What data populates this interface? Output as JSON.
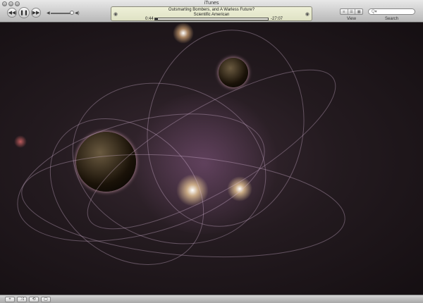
{
  "window": {
    "title": "iTunes"
  },
  "controls": {
    "prev": "◀◀",
    "pause": "❚❚",
    "next": "▶▶",
    "vol_low": "◀",
    "vol_high": "◀)"
  },
  "now_playing": {
    "title": "Outsmarting Bombers, and A Warless Future?",
    "artist": "Scientific American",
    "elapsed": "0:44",
    "remaining": "-27:07",
    "progress_fraction": 0.026
  },
  "view": {
    "label": "View",
    "buttons": [
      "≡",
      "☰",
      "▦"
    ]
  },
  "search": {
    "label": "Search",
    "placeholder": "Q▾"
  },
  "bottom": {
    "buttons": [
      "+",
      "⤨",
      "⟲",
      "▢"
    ]
  }
}
